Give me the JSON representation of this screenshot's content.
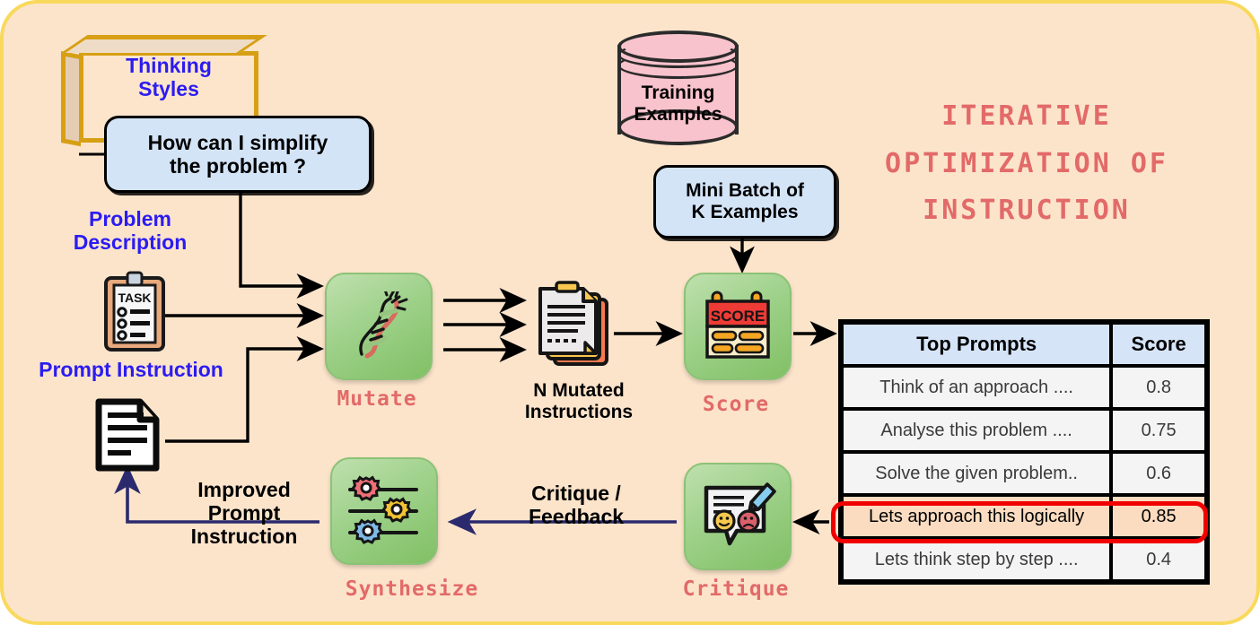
{
  "title": "ITERATIVE\nOPTIMIZATION OF\nINSTRUCTION",
  "frame": {
    "bg": "#fce4cb",
    "border": "#f9d95c"
  },
  "colors": {
    "blue_label": "#2b1cf0",
    "salmon": "#e26a68",
    "tile_green": "#9ed18a",
    "speech_blue": "#d4e4f7",
    "cylinder_pink": "#f9c3cd",
    "box_gold": "#d79f14",
    "highlight_red": "#f10000",
    "feedback_arrow": "#2b2a6e"
  },
  "inputs": {
    "thinking_styles_label": "Thinking\nStyles",
    "thinking_styles_example": "How can I simplify\nthe problem ?",
    "problem_description_label": "Problem\nDescription",
    "problem_description_icon": "clipboard-task-icon",
    "prompt_instruction_label": "Prompt Instruction",
    "prompt_instruction_icon": "document-icon"
  },
  "data_source": {
    "training_examples_label": "Training\nExamples",
    "training_examples_icon": "database-cylinder-icon",
    "mini_batch_label": "Mini Batch of\nK Examples"
  },
  "stages": {
    "mutate": {
      "label": "Mutate",
      "icon": "dna-mutation-icon"
    },
    "score": {
      "label": "Score",
      "icon": "scoreboard-icon"
    },
    "critique": {
      "label": "Critique",
      "icon": "feedback-comment-icon"
    },
    "synthesize": {
      "label": "Synthesize",
      "icon": "gear-sliders-icon"
    }
  },
  "intermediate": {
    "n_mutated_label": "N Mutated\nInstructions",
    "n_mutated_icon": "stacked-documents-icon"
  },
  "edges": {
    "critique_feedback_label": "Critique /\nFeedback",
    "improved_prompt_label": "Improved\nPrompt\nInstruction"
  },
  "table": {
    "headers": [
      "Top Prompts",
      "Score"
    ],
    "rows": [
      {
        "prompt": "Think of an approach ....",
        "score": "0.8",
        "highlighted": false
      },
      {
        "prompt": "Analyse this problem ....",
        "score": "0.75",
        "highlighted": false
      },
      {
        "prompt": "Solve the given problem..",
        "score": "0.6",
        "highlighted": false
      },
      {
        "prompt": "Lets approach this logically",
        "score": "0.85",
        "highlighted": true
      },
      {
        "prompt": "Lets think step by step ....",
        "score": "0.4",
        "highlighted": false
      }
    ]
  }
}
